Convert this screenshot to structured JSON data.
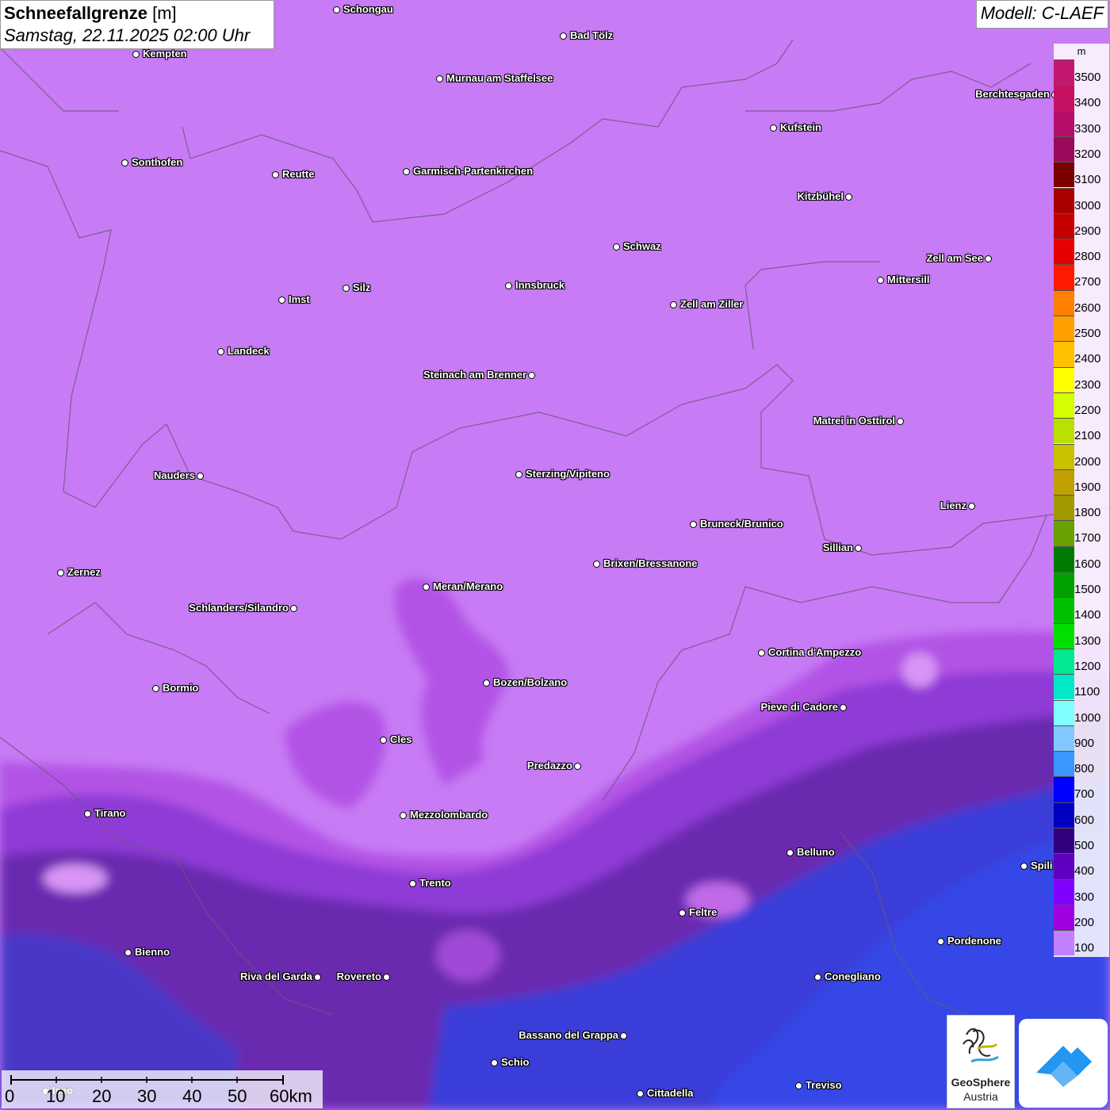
{
  "header": {
    "title": "Schneefallgrenze",
    "unit": "[m]",
    "datetime": "Samstag, 22.11.2025 02:00 Uhr",
    "model": "Modell: C-LAEF"
  },
  "legend": {
    "unit": "m",
    "levels": [
      {
        "value": "3500",
        "color": "#c2186e"
      },
      {
        "value": "3400",
        "color": "#c41162"
      },
      {
        "value": "3300",
        "color": "#b50e6a"
      },
      {
        "value": "3200",
        "color": "#9b0a5a"
      },
      {
        "value": "3100",
        "color": "#7a0000"
      },
      {
        "value": "3000",
        "color": "#a80000"
      },
      {
        "value": "2900",
        "color": "#c40000"
      },
      {
        "value": "2800",
        "color": "#e60000"
      },
      {
        "value": "2700",
        "color": "#ff1a00"
      },
      {
        "value": "2600",
        "color": "#ff7f00"
      },
      {
        "value": "2500",
        "color": "#ffa000"
      },
      {
        "value": "2400",
        "color": "#ffc000"
      },
      {
        "value": "2300",
        "color": "#ffff00"
      },
      {
        "value": "2200",
        "color": "#d4ff00"
      },
      {
        "value": "2100",
        "color": "#b8e000"
      },
      {
        "value": "2000",
        "color": "#c8c000"
      },
      {
        "value": "1900",
        "color": "#c0a000"
      },
      {
        "value": "1800",
        "color": "#a09a00"
      },
      {
        "value": "1700",
        "color": "#6aa000"
      },
      {
        "value": "1600",
        "color": "#007a00"
      },
      {
        "value": "1500",
        "color": "#00a000"
      },
      {
        "value": "1400",
        "color": "#00c000"
      },
      {
        "value": "1300",
        "color": "#00e000"
      },
      {
        "value": "1200",
        "color": "#00e890"
      },
      {
        "value": "1100",
        "color": "#00e8c8"
      },
      {
        "value": "1000",
        "color": "#80ffff"
      },
      {
        "value": "900",
        "color": "#80c8ff"
      },
      {
        "value": "800",
        "color": "#3c96ff"
      },
      {
        "value": "700",
        "color": "#0000ff"
      },
      {
        "value": "600",
        "color": "#0000c0"
      },
      {
        "value": "500",
        "color": "#300080"
      },
      {
        "value": "400",
        "color": "#6000c0"
      },
      {
        "value": "300",
        "color": "#8000ff"
      },
      {
        "value": "200",
        "color": "#a000e0"
      },
      {
        "value": "100",
        "color": "#c080ff"
      }
    ]
  },
  "cities": [
    {
      "name": "Schongau",
      "label_side": "right"
    },
    {
      "name": "Bad Tölz",
      "label_side": "right"
    },
    {
      "name": "Kempten",
      "label_side": "right"
    },
    {
      "name": "Murnau am Staffelsee",
      "label_side": "right"
    },
    {
      "name": "Berchtesgaden",
      "label_side": "left"
    },
    {
      "name": "Kufstein",
      "label_side": "right"
    },
    {
      "name": "Sonthofen",
      "label_side": "right"
    },
    {
      "name": "Reutte",
      "label_side": "right"
    },
    {
      "name": "Garmisch-Partenkirchen",
      "label_side": "right"
    },
    {
      "name": "Kitzbühel",
      "label_side": "left"
    },
    {
      "name": "Schwaz",
      "label_side": "right"
    },
    {
      "name": "Zell am See",
      "label_side": "left"
    },
    {
      "name": "Innsbruck",
      "label_side": "right"
    },
    {
      "name": "Mittersill",
      "label_side": "right"
    },
    {
      "name": "Imst",
      "label_side": "right"
    },
    {
      "name": "Silz",
      "label_side": "right"
    },
    {
      "name": "Zell am Ziller",
      "label_side": "right"
    },
    {
      "name": "Landeck",
      "label_side": "right"
    },
    {
      "name": "Steinach am Brenner",
      "label_side": "left"
    },
    {
      "name": "Matrei in Osttirol",
      "label_side": "left"
    },
    {
      "name": "Nauders",
      "label_side": "left"
    },
    {
      "name": "Sterzing/Vipiteno",
      "label_side": "right"
    },
    {
      "name": "Lienz",
      "label_side": "left"
    },
    {
      "name": "Bruneck/Brunico",
      "label_side": "right"
    },
    {
      "name": "Sillian",
      "label_side": "left"
    },
    {
      "name": "Zernez",
      "label_side": "right"
    },
    {
      "name": "Brixen/Bressanone",
      "label_side": "right"
    },
    {
      "name": "Meran/Merano",
      "label_side": "right"
    },
    {
      "name": "Schlanders/Silandro",
      "label_side": "left"
    },
    {
      "name": "Cortina d'Ampezzo",
      "label_side": "right"
    },
    {
      "name": "Bozen/Bolzano",
      "label_side": "right"
    },
    {
      "name": "Bormio",
      "label_side": "right"
    },
    {
      "name": "Pieve di Cadore",
      "label_side": "left"
    },
    {
      "name": "Cles",
      "label_side": "right"
    },
    {
      "name": "Predazzo",
      "label_side": "left"
    },
    {
      "name": "Tirano",
      "label_side": "right"
    },
    {
      "name": "Mezzolombardo",
      "label_side": "right"
    },
    {
      "name": "Belluno",
      "label_side": "right"
    },
    {
      "name": "Spili",
      "label_side": "right"
    },
    {
      "name": "Trento",
      "label_side": "right"
    },
    {
      "name": "Feltre",
      "label_side": "right"
    },
    {
      "name": "Pordenone",
      "label_side": "right"
    },
    {
      "name": "Bienno",
      "label_side": "right"
    },
    {
      "name": "Riva del Garda",
      "label_side": "left"
    },
    {
      "name": "Rovereto",
      "label_side": "left"
    },
    {
      "name": "Conegliano",
      "label_side": "right"
    },
    {
      "name": "Bassano del Grappa",
      "label_side": "left"
    },
    {
      "name": "Schio",
      "label_side": "right"
    },
    {
      "name": "Treviso",
      "label_side": "right"
    },
    {
      "name": "Cittadella",
      "label_side": "right"
    },
    {
      "name": "Iseo",
      "label_side": "right"
    }
  ],
  "scalebar": {
    "ticks": [
      "0",
      "10",
      "20",
      "30",
      "40",
      "50",
      "60km"
    ]
  },
  "logos": {
    "geosphere_line1": "GeoSphere",
    "geosphere_line2": "Austria"
  }
}
